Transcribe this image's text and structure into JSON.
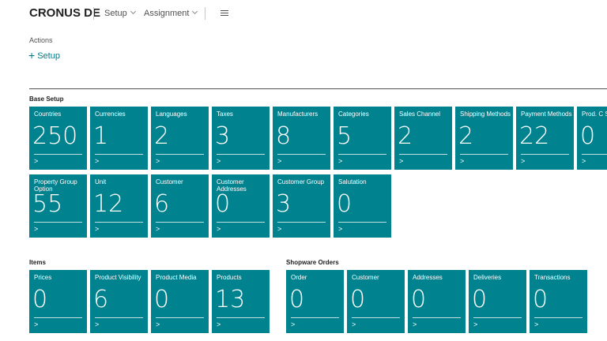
{
  "header": {
    "company": "CRONUS DE",
    "menu": [
      {
        "label": "Setup"
      },
      {
        "label": "Assignment"
      }
    ]
  },
  "actions": {
    "label": "Actions",
    "setup_label": "Setup"
  },
  "groups": {
    "base_setup": {
      "title": "Base Setup",
      "tiles": [
        {
          "label": "Countries",
          "value": "250"
        },
        {
          "label": "Currencies",
          "value": "1"
        },
        {
          "label": "Languages",
          "value": "2"
        },
        {
          "label": "Taxes",
          "value": "3"
        },
        {
          "label": "Manufacturers",
          "value": "8"
        },
        {
          "label": "Categories",
          "value": "5"
        },
        {
          "label": "Sales Channel",
          "value": "2"
        },
        {
          "label": "Shipping Methods",
          "value": "2"
        },
        {
          "label": "Payment Methods",
          "value": "22"
        },
        {
          "label": "Prod. C Setting",
          "value": "0"
        },
        {
          "label": "Property Group Option",
          "value": "55"
        },
        {
          "label": "Unit",
          "value": "12"
        },
        {
          "label": "Customer",
          "value": "6"
        },
        {
          "label": "Customer Addresses",
          "value": "0"
        },
        {
          "label": "Customer Group",
          "value": "3"
        },
        {
          "label": "Salutation",
          "value": "0"
        }
      ]
    },
    "items": {
      "title": "Items",
      "tiles": [
        {
          "label": "Prices",
          "value": "0"
        },
        {
          "label": "Product Visibility",
          "value": "6"
        },
        {
          "label": "Product Media",
          "value": "0"
        },
        {
          "label": "Products",
          "value": "13"
        }
      ]
    },
    "shopware_orders": {
      "title": "Shopware Orders",
      "tiles": [
        {
          "label": "Order",
          "value": "0"
        },
        {
          "label": "Customer",
          "value": "0"
        },
        {
          "label": "Addresses",
          "value": "0"
        },
        {
          "label": "Deliveries",
          "value": "0"
        },
        {
          "label": "Transactions",
          "value": "0"
        }
      ]
    }
  },
  "tile_arrow": ">",
  "colors": {
    "tile_background": "#00838f",
    "accent": "#00788a"
  }
}
